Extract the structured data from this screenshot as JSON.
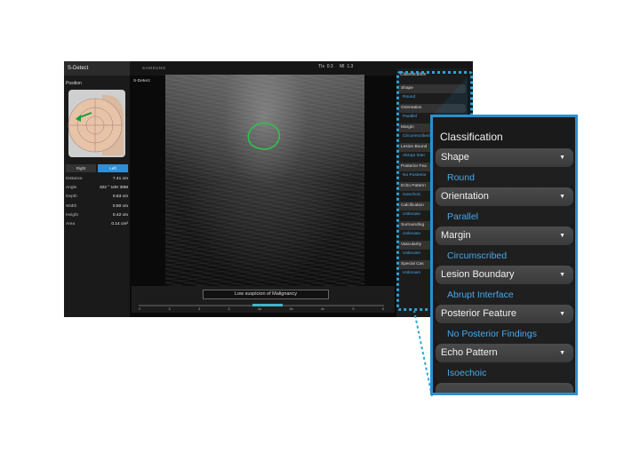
{
  "app": {
    "title": "S-Detect",
    "brand": "SAMSUNG",
    "tis_label": "TIs",
    "tis_value": "0.3",
    "mi_label": "MI",
    "mi_value": "1.3",
    "image_label": "S-Detect"
  },
  "left_panel": {
    "position_label": "Position",
    "side_buttons": {
      "right": "Right",
      "left": "Left",
      "active": "left"
    },
    "measurements": [
      {
        "label": "Distance",
        "value": "7.41 cm"
      },
      {
        "label": "Angle",
        "value": "322 ° 10H 30M"
      },
      {
        "label": "Depth",
        "value": "0.63 cm"
      },
      {
        "label": "Width",
        "value": "0.50 cm"
      },
      {
        "label": "Height",
        "value": "0.42 cm"
      },
      {
        "label": "Area",
        "value": "0.14 cm²"
      }
    ]
  },
  "result": {
    "text": "Low suspicion of Malignancy",
    "scale_ticks": [
      "2",
      "3",
      "3",
      "3",
      "4a",
      "4b",
      "4c",
      "5",
      "6"
    ]
  },
  "classification_small": {
    "title": "Classification",
    "items": [
      {
        "header": "Shape",
        "value": "Round"
      },
      {
        "header": "Orientation",
        "value": "Parallel"
      },
      {
        "header": "Margin",
        "value": "Circumscribed"
      },
      {
        "header": "Lesion Bound",
        "value": "Abrupt Inter"
      },
      {
        "header": "Posterior Fea",
        "value": "No Posterior"
      },
      {
        "header": "Echo Pattern",
        "value": "Isoechoic"
      },
      {
        "header": "Calcification",
        "value": "Unknown"
      },
      {
        "header": "Surrounding",
        "value": "Unknown"
      },
      {
        "header": "Vascularity",
        "value": "Unknown"
      },
      {
        "header": "Special Cas",
        "value": "Unknown"
      }
    ]
  },
  "classification_zoom": {
    "title": "Classification",
    "items": [
      {
        "header": "Shape",
        "value": "Round"
      },
      {
        "header": "Orientation",
        "value": "Parallel"
      },
      {
        "header": "Margin",
        "value": "Circumscribed"
      },
      {
        "header": "Lesion Boundary",
        "value": "Abrupt Interface"
      },
      {
        "header": "Posterior Feature",
        "value": "No Posterior Findings"
      },
      {
        "header": "Echo Pattern",
        "value": "Isoechoic"
      }
    ]
  },
  "colors": {
    "accent": "#2a8fcf",
    "value_text": "#4aa9ea",
    "highlight": "#3fb7c9"
  }
}
